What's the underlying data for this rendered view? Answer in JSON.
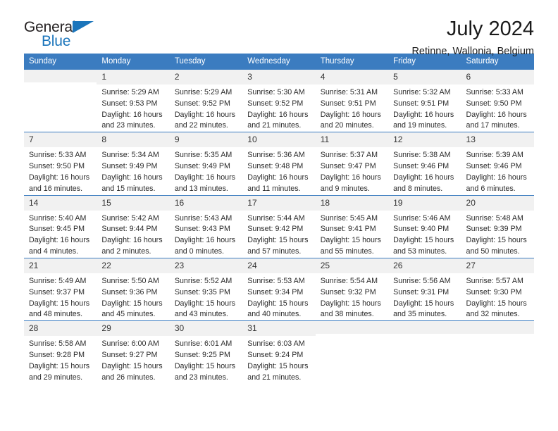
{
  "brand": {
    "name_top": "General",
    "name_bottom": "Blue",
    "triangle_color": "#1b75bb",
    "text_color": "#231f20"
  },
  "header": {
    "title": "July 2024",
    "subtitle": "Retinne, Wallonia, Belgium"
  },
  "theme": {
    "header_bg": "#3b7cc0",
    "header_text": "#ffffff",
    "daynum_bg": "#f1f1f1",
    "cell_bg": "#ffffff",
    "grid_line": "#3b7cc0",
    "body_text": "#2b2b2b"
  },
  "calendar": {
    "weekday_headers": [
      "Sunday",
      "Monday",
      "Tuesday",
      "Wednesday",
      "Thursday",
      "Friday",
      "Saturday"
    ],
    "labels": {
      "sunrise": "Sunrise:",
      "sunset": "Sunset:",
      "daylight": "Daylight:"
    },
    "weeks": [
      [
        {
          "day": ""
        },
        {
          "day": "1",
          "sunrise": "Sunrise: 5:29 AM",
          "sunset": "Sunset: 9:53 PM",
          "daylight_1": "Daylight: 16 hours",
          "daylight_2": "and 23 minutes."
        },
        {
          "day": "2",
          "sunrise": "Sunrise: 5:29 AM",
          "sunset": "Sunset: 9:52 PM",
          "daylight_1": "Daylight: 16 hours",
          "daylight_2": "and 22 minutes."
        },
        {
          "day": "3",
          "sunrise": "Sunrise: 5:30 AM",
          "sunset": "Sunset: 9:52 PM",
          "daylight_1": "Daylight: 16 hours",
          "daylight_2": "and 21 minutes."
        },
        {
          "day": "4",
          "sunrise": "Sunrise: 5:31 AM",
          "sunset": "Sunset: 9:51 PM",
          "daylight_1": "Daylight: 16 hours",
          "daylight_2": "and 20 minutes."
        },
        {
          "day": "5",
          "sunrise": "Sunrise: 5:32 AM",
          "sunset": "Sunset: 9:51 PM",
          "daylight_1": "Daylight: 16 hours",
          "daylight_2": "and 19 minutes."
        },
        {
          "day": "6",
          "sunrise": "Sunrise: 5:33 AM",
          "sunset": "Sunset: 9:50 PM",
          "daylight_1": "Daylight: 16 hours",
          "daylight_2": "and 17 minutes."
        }
      ],
      [
        {
          "day": "7",
          "sunrise": "Sunrise: 5:33 AM",
          "sunset": "Sunset: 9:50 PM",
          "daylight_1": "Daylight: 16 hours",
          "daylight_2": "and 16 minutes."
        },
        {
          "day": "8",
          "sunrise": "Sunrise: 5:34 AM",
          "sunset": "Sunset: 9:49 PM",
          "daylight_1": "Daylight: 16 hours",
          "daylight_2": "and 15 minutes."
        },
        {
          "day": "9",
          "sunrise": "Sunrise: 5:35 AM",
          "sunset": "Sunset: 9:49 PM",
          "daylight_1": "Daylight: 16 hours",
          "daylight_2": "and 13 minutes."
        },
        {
          "day": "10",
          "sunrise": "Sunrise: 5:36 AM",
          "sunset": "Sunset: 9:48 PM",
          "daylight_1": "Daylight: 16 hours",
          "daylight_2": "and 11 minutes."
        },
        {
          "day": "11",
          "sunrise": "Sunrise: 5:37 AM",
          "sunset": "Sunset: 9:47 PM",
          "daylight_1": "Daylight: 16 hours",
          "daylight_2": "and 9 minutes."
        },
        {
          "day": "12",
          "sunrise": "Sunrise: 5:38 AM",
          "sunset": "Sunset: 9:46 PM",
          "daylight_1": "Daylight: 16 hours",
          "daylight_2": "and 8 minutes."
        },
        {
          "day": "13",
          "sunrise": "Sunrise: 5:39 AM",
          "sunset": "Sunset: 9:46 PM",
          "daylight_1": "Daylight: 16 hours",
          "daylight_2": "and 6 minutes."
        }
      ],
      [
        {
          "day": "14",
          "sunrise": "Sunrise: 5:40 AM",
          "sunset": "Sunset: 9:45 PM",
          "daylight_1": "Daylight: 16 hours",
          "daylight_2": "and 4 minutes."
        },
        {
          "day": "15",
          "sunrise": "Sunrise: 5:42 AM",
          "sunset": "Sunset: 9:44 PM",
          "daylight_1": "Daylight: 16 hours",
          "daylight_2": "and 2 minutes."
        },
        {
          "day": "16",
          "sunrise": "Sunrise: 5:43 AM",
          "sunset": "Sunset: 9:43 PM",
          "daylight_1": "Daylight: 16 hours",
          "daylight_2": "and 0 minutes."
        },
        {
          "day": "17",
          "sunrise": "Sunrise: 5:44 AM",
          "sunset": "Sunset: 9:42 PM",
          "daylight_1": "Daylight: 15 hours",
          "daylight_2": "and 57 minutes."
        },
        {
          "day": "18",
          "sunrise": "Sunrise: 5:45 AM",
          "sunset": "Sunset: 9:41 PM",
          "daylight_1": "Daylight: 15 hours",
          "daylight_2": "and 55 minutes."
        },
        {
          "day": "19",
          "sunrise": "Sunrise: 5:46 AM",
          "sunset": "Sunset: 9:40 PM",
          "daylight_1": "Daylight: 15 hours",
          "daylight_2": "and 53 minutes."
        },
        {
          "day": "20",
          "sunrise": "Sunrise: 5:48 AM",
          "sunset": "Sunset: 9:39 PM",
          "daylight_1": "Daylight: 15 hours",
          "daylight_2": "and 50 minutes."
        }
      ],
      [
        {
          "day": "21",
          "sunrise": "Sunrise: 5:49 AM",
          "sunset": "Sunset: 9:37 PM",
          "daylight_1": "Daylight: 15 hours",
          "daylight_2": "and 48 minutes."
        },
        {
          "day": "22",
          "sunrise": "Sunrise: 5:50 AM",
          "sunset": "Sunset: 9:36 PM",
          "daylight_1": "Daylight: 15 hours",
          "daylight_2": "and 45 minutes."
        },
        {
          "day": "23",
          "sunrise": "Sunrise: 5:52 AM",
          "sunset": "Sunset: 9:35 PM",
          "daylight_1": "Daylight: 15 hours",
          "daylight_2": "and 43 minutes."
        },
        {
          "day": "24",
          "sunrise": "Sunrise: 5:53 AM",
          "sunset": "Sunset: 9:34 PM",
          "daylight_1": "Daylight: 15 hours",
          "daylight_2": "and 40 minutes."
        },
        {
          "day": "25",
          "sunrise": "Sunrise: 5:54 AM",
          "sunset": "Sunset: 9:32 PM",
          "daylight_1": "Daylight: 15 hours",
          "daylight_2": "and 38 minutes."
        },
        {
          "day": "26",
          "sunrise": "Sunrise: 5:56 AM",
          "sunset": "Sunset: 9:31 PM",
          "daylight_1": "Daylight: 15 hours",
          "daylight_2": "and 35 minutes."
        },
        {
          "day": "27",
          "sunrise": "Sunrise: 5:57 AM",
          "sunset": "Sunset: 9:30 PM",
          "daylight_1": "Daylight: 15 hours",
          "daylight_2": "and 32 minutes."
        }
      ],
      [
        {
          "day": "28",
          "sunrise": "Sunrise: 5:58 AM",
          "sunset": "Sunset: 9:28 PM",
          "daylight_1": "Daylight: 15 hours",
          "daylight_2": "and 29 minutes."
        },
        {
          "day": "29",
          "sunrise": "Sunrise: 6:00 AM",
          "sunset": "Sunset: 9:27 PM",
          "daylight_1": "Daylight: 15 hours",
          "daylight_2": "and 26 minutes."
        },
        {
          "day": "30",
          "sunrise": "Sunrise: 6:01 AM",
          "sunset": "Sunset: 9:25 PM",
          "daylight_1": "Daylight: 15 hours",
          "daylight_2": "and 23 minutes."
        },
        {
          "day": "31",
          "sunrise": "Sunrise: 6:03 AM",
          "sunset": "Sunset: 9:24 PM",
          "daylight_1": "Daylight: 15 hours",
          "daylight_2": "and 21 minutes."
        },
        {
          "day": ""
        },
        {
          "day": ""
        },
        {
          "day": ""
        }
      ]
    ]
  }
}
